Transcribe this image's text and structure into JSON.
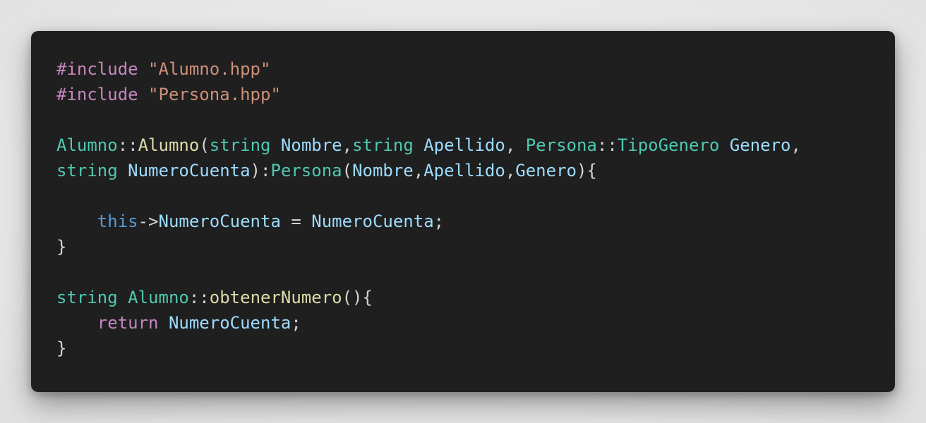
{
  "theme": {
    "background": "#1f1f1f",
    "colors": {
      "preprocessor": "#c586c0",
      "string": "#ce9178",
      "type": "#4ec9b0",
      "function": "#dcdcaa",
      "variable": "#9cdcfe",
      "this_keyword": "#569cd6",
      "control_keyword": "#c586c0",
      "punctuation": "#d4d4d4"
    }
  },
  "code_lines": [
    [
      {
        "t": "#include",
        "k": "kw-pre"
      },
      {
        "t": " ",
        "k": "punc"
      },
      {
        "t": "\"Alumno.hpp\"",
        "k": "str"
      }
    ],
    [
      {
        "t": "#include",
        "k": "kw-pre"
      },
      {
        "t": " ",
        "k": "punc"
      },
      {
        "t": "\"Persona.hpp\"",
        "k": "str"
      }
    ],
    [],
    [
      {
        "t": "Alumno",
        "k": "type"
      },
      {
        "t": "::",
        "k": "punc"
      },
      {
        "t": "Alumno",
        "k": "fn"
      },
      {
        "t": "(",
        "k": "punc"
      },
      {
        "t": "string",
        "k": "type"
      },
      {
        "t": " ",
        "k": "punc"
      },
      {
        "t": "Nombre",
        "k": "var"
      },
      {
        "t": ",",
        "k": "punc"
      },
      {
        "t": "string",
        "k": "type"
      },
      {
        "t": " ",
        "k": "punc"
      },
      {
        "t": "Apellido",
        "k": "var"
      },
      {
        "t": ", ",
        "k": "punc"
      },
      {
        "t": "Persona",
        "k": "type"
      },
      {
        "t": "::",
        "k": "punc"
      },
      {
        "t": "TipoGenero",
        "k": "type"
      },
      {
        "t": " ",
        "k": "punc"
      },
      {
        "t": "Genero",
        "k": "var"
      },
      {
        "t": ",",
        "k": "punc"
      }
    ],
    [
      {
        "t": "string",
        "k": "type"
      },
      {
        "t": " ",
        "k": "punc"
      },
      {
        "t": "NumeroCuenta",
        "k": "var"
      },
      {
        "t": "):",
        "k": "punc"
      },
      {
        "t": "Persona",
        "k": "type"
      },
      {
        "t": "(",
        "k": "punc"
      },
      {
        "t": "Nombre",
        "k": "var"
      },
      {
        "t": ",",
        "k": "punc"
      },
      {
        "t": "Apellido",
        "k": "var"
      },
      {
        "t": ",",
        "k": "punc"
      },
      {
        "t": "Genero",
        "k": "var"
      },
      {
        "t": "){",
        "k": "punc"
      }
    ],
    [],
    [
      {
        "t": "    ",
        "k": "punc"
      },
      {
        "t": "this",
        "k": "this"
      },
      {
        "t": "->",
        "k": "punc"
      },
      {
        "t": "NumeroCuenta",
        "k": "var"
      },
      {
        "t": " = ",
        "k": "punc"
      },
      {
        "t": "NumeroCuenta",
        "k": "var"
      },
      {
        "t": ";",
        "k": "punc"
      }
    ],
    [
      {
        "t": "}",
        "k": "punc"
      }
    ],
    [],
    [
      {
        "t": "string",
        "k": "type"
      },
      {
        "t": " ",
        "k": "punc"
      },
      {
        "t": "Alumno",
        "k": "type"
      },
      {
        "t": "::",
        "k": "punc"
      },
      {
        "t": "obtenerNumero",
        "k": "fn"
      },
      {
        "t": "(){",
        "k": "punc"
      }
    ],
    [
      {
        "t": "    ",
        "k": "punc"
      },
      {
        "t": "return",
        "k": "ctrl"
      },
      {
        "t": " ",
        "k": "punc"
      },
      {
        "t": "NumeroCuenta",
        "k": "var"
      },
      {
        "t": ";",
        "k": "punc"
      }
    ],
    [
      {
        "t": "}",
        "k": "punc"
      }
    ]
  ]
}
